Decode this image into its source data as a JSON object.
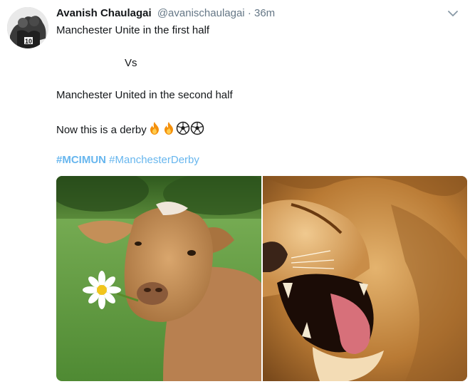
{
  "tweet": {
    "author_name": "Avanish Chaulagai",
    "handle": "@avanischaulagai",
    "separator": "·",
    "time": "36m",
    "lines": [
      "Manchester Unite in the first half",
      "Vs",
      "Manchester United in the second half",
      "Now this is a derby"
    ],
    "emojis": [
      "fire-emoji",
      "fire-emoji",
      "soccer-ball-emoji",
      "soccer-ball-emoji"
    ],
    "hashtags": [
      "#MCIMUN",
      "#ManchesterDerby"
    ],
    "menu_icon": "chevron-down-icon",
    "avatar_icon": "avatar"
  },
  "media": {
    "photos": [
      "goat-photo",
      "lion-photo"
    ]
  },
  "colors": {
    "hashtag": "#67b6ee",
    "secondary_text": "#657786",
    "primary_text": "#14171a"
  }
}
